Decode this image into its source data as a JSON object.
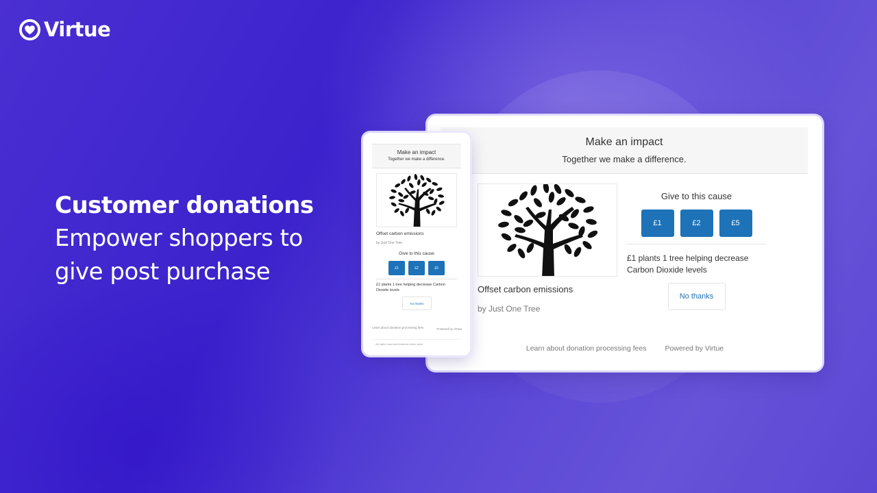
{
  "brand": {
    "name": "Virtue",
    "icon": "heart-in-circle-icon"
  },
  "hero": {
    "title": "Customer donations",
    "subtitle_line1": "Empower shoppers to",
    "subtitle_line2": "give post purchase"
  },
  "colors": {
    "background_primary": "#3b22cc",
    "background_accent": "#6653d8",
    "button_primary": "#1d72b8",
    "link": "#1d72b8",
    "text": "#333333",
    "muted_text": "#777777"
  },
  "widget": {
    "header_title": "Make an impact",
    "header_subtitle": "Together we make a difference.",
    "cause_image": "tree-icon",
    "cause_name": "Offset carbon emissions",
    "cause_by": "by Just One Tree",
    "give_label": "Give to this cause",
    "amounts": [
      "£1",
      "£2",
      "£5"
    ],
    "description": "£1 plants 1 tree helping decrease Carbon Dioxide levels",
    "no_thanks_label": "No thanks",
    "fees_link": "Learn about donation processing fees",
    "powered_by": "Powered by Virtue",
    "rights": "All rights reserved Andrews virtue store"
  }
}
